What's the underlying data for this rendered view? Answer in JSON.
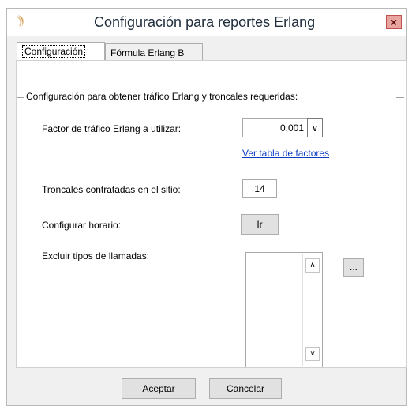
{
  "window": {
    "title": "Configuración para reportes Erlang",
    "close_label": "×"
  },
  "tabs": [
    {
      "label": "Configuración",
      "active": true
    },
    {
      "label": "Fórmula Erlang B",
      "active": false
    }
  ],
  "group": {
    "title": "Configuración para obtener tráfico Erlang y troncales requeridas:"
  },
  "factor": {
    "label": "Factor de tráfico Erlang a utilizar:",
    "value": "0.001",
    "dropdown_glyph": "∨",
    "link": "Ver tabla de factores"
  },
  "trunks": {
    "label": "Troncales contratadas en el sitio:",
    "value": "14"
  },
  "schedule": {
    "label": "Configurar horario:",
    "button": "Ir"
  },
  "exclude": {
    "label": "Excluir tipos de llamadas:",
    "browse_button": "...",
    "up_glyph": "∧",
    "down_glyph": "∨"
  },
  "footer": {
    "accept_first": "A",
    "accept_rest": "ceptar",
    "cancel": "Cancelar"
  },
  "colors": {
    "link": "#0a3cc4",
    "title_text": "#1f2d3d",
    "close_bg": "#e8a49f"
  }
}
